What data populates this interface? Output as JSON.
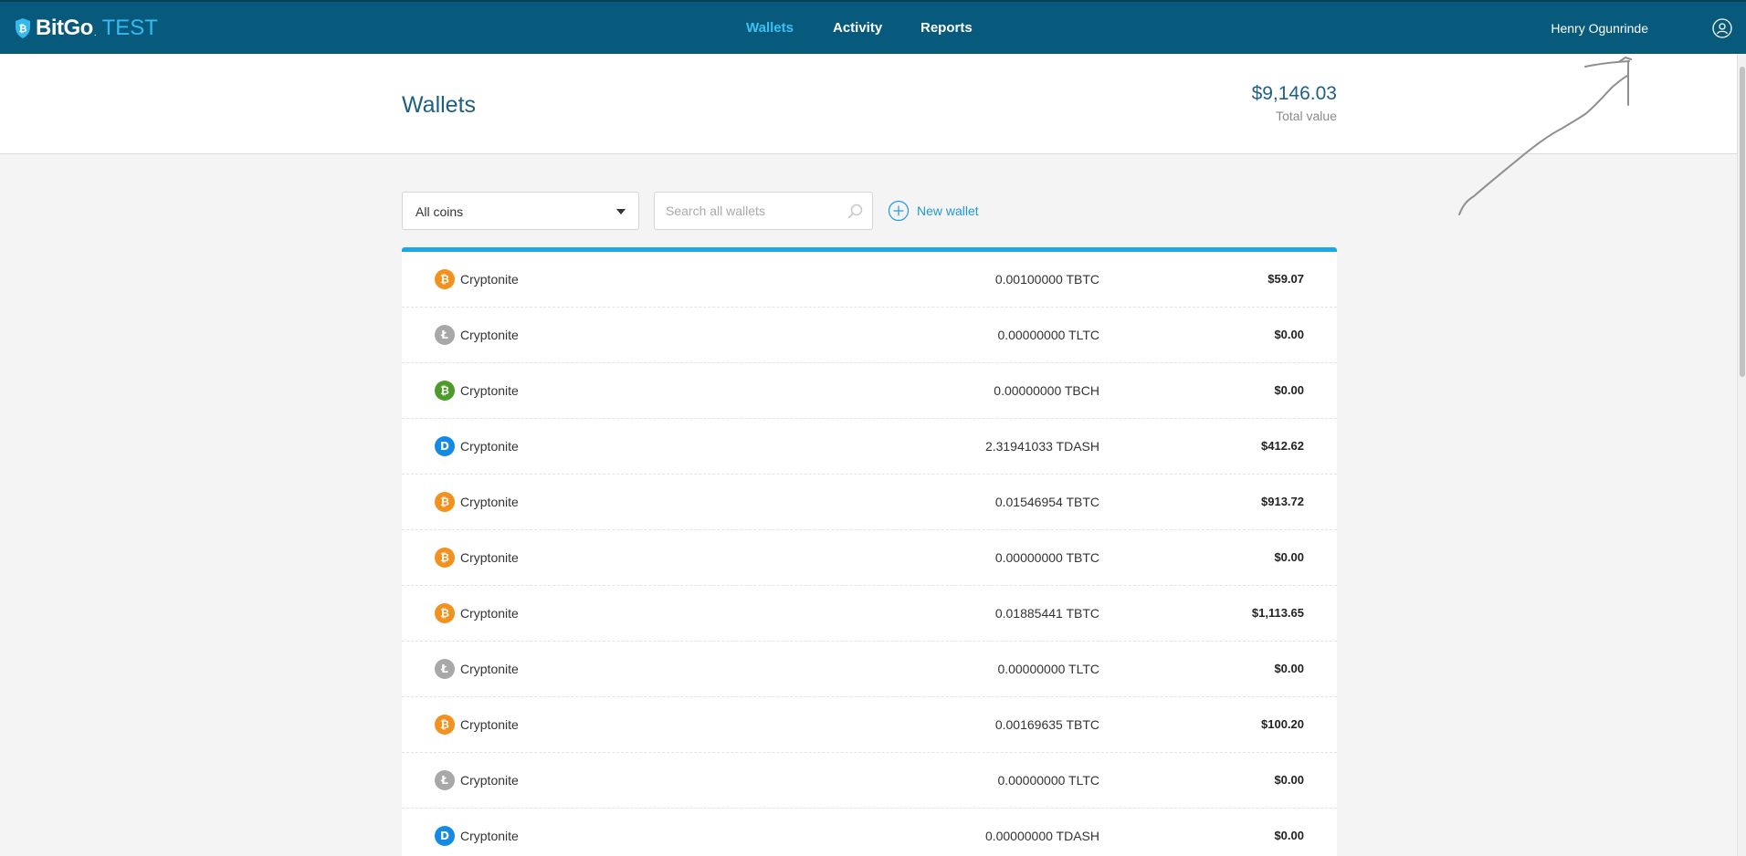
{
  "app": {
    "brand": "BitGo",
    "brand_mark": ".",
    "env": "TEST"
  },
  "nav": [
    {
      "label": "Wallets",
      "active": true
    },
    {
      "label": "Activity",
      "active": false
    },
    {
      "label": "Reports",
      "active": false
    }
  ],
  "user": {
    "name": "Henry Ogunrinde"
  },
  "header": {
    "title": "Wallets",
    "total_value": "$9,146.03",
    "total_label": "Total value"
  },
  "filters": {
    "coin_select": "All coins",
    "search_placeholder": "Search all wallets",
    "search_value": "",
    "new_wallet_label": "New wallet"
  },
  "colors": {
    "topbar": "#075a7c",
    "accent": "#1ca8e6",
    "btc": "#f2911e",
    "ltc": "#a8a8a8",
    "bch": "#4c9b2b",
    "dash": "#158ae4"
  },
  "wallets": [
    {
      "coin": "btc",
      "glyph": "₿",
      "name": "Cryptonite",
      "balance": "0.00100000 TBTC",
      "usd": "$59.07"
    },
    {
      "coin": "ltc",
      "glyph": "Ł",
      "name": "Cryptonite",
      "balance": "0.00000000 TLTC",
      "usd": "$0.00"
    },
    {
      "coin": "bch",
      "glyph": "₿",
      "name": "Cryptonite",
      "balance": "0.00000000 TBCH",
      "usd": "$0.00"
    },
    {
      "coin": "dash",
      "glyph": "D",
      "name": "Cryptonite",
      "balance": "2.31941033 TDASH",
      "usd": "$412.62"
    },
    {
      "coin": "btc",
      "glyph": "₿",
      "name": "Cryptonite",
      "balance": "0.01546954 TBTC",
      "usd": "$913.72"
    },
    {
      "coin": "btc",
      "glyph": "₿",
      "name": "Cryptonite",
      "balance": "0.00000000 TBTC",
      "usd": "$0.00"
    },
    {
      "coin": "btc",
      "glyph": "₿",
      "name": "Cryptonite",
      "balance": "0.01885441 TBTC",
      "usd": "$1,113.65"
    },
    {
      "coin": "ltc",
      "glyph": "Ł",
      "name": "Cryptonite",
      "balance": "0.00000000 TLTC",
      "usd": "$0.00"
    },
    {
      "coin": "btc",
      "glyph": "₿",
      "name": "Cryptonite",
      "balance": "0.00169635 TBTC",
      "usd": "$100.20"
    },
    {
      "coin": "ltc",
      "glyph": "Ł",
      "name": "Cryptonite",
      "balance": "0.00000000 TLTC",
      "usd": "$0.00"
    },
    {
      "coin": "dash",
      "glyph": "D",
      "name": "Cryptonite",
      "balance": "0.00000000 TDASH",
      "usd": "$0.00"
    }
  ]
}
